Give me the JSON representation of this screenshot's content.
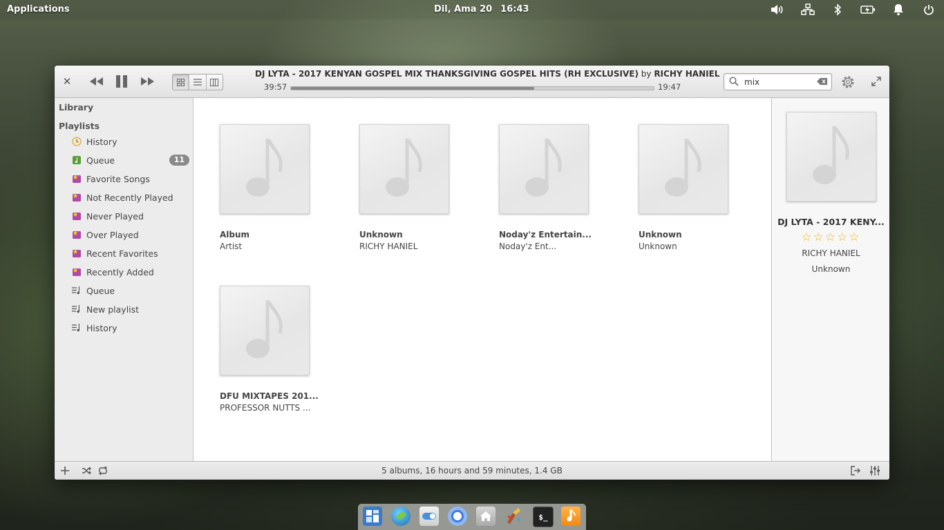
{
  "panel": {
    "applications_label": "Applications",
    "date": "Dil, Ama 20",
    "time": "16:43"
  },
  "player": {
    "track_title": "DJ LYTA  - 2017 KENYAN GOSPEL MIX  THANKSGIVING GOSPEL HITS (RH EXCLUSIVE)",
    "by_word": "by",
    "track_artist": "RICHY HANIEL",
    "elapsed": "39:57",
    "remaining": "19:47",
    "progress_fraction": 0.67
  },
  "search": {
    "value": "mix"
  },
  "sidebar": {
    "library_label": "Library",
    "playlists_label": "Playlists",
    "items": [
      {
        "label": "History",
        "icon": "history-icon"
      },
      {
        "label": "Queue",
        "icon": "queue-icon",
        "badge": "11"
      },
      {
        "label": "Favorite Songs",
        "icon": "smart-playlist-icon"
      },
      {
        "label": "Not Recently Played",
        "icon": "smart-playlist-icon"
      },
      {
        "label": "Never Played",
        "icon": "smart-playlist-icon"
      },
      {
        "label": "Over Played",
        "icon": "smart-playlist-icon"
      },
      {
        "label": "Recent Favorites",
        "icon": "smart-playlist-icon"
      },
      {
        "label": "Recently Added",
        "icon": "smart-playlist-icon"
      },
      {
        "label": "Queue",
        "icon": "playlist-icon"
      },
      {
        "label": "New playlist",
        "icon": "playlist-icon"
      },
      {
        "label": "History",
        "icon": "playlist-icon"
      }
    ]
  },
  "albums": [
    {
      "title": "Album",
      "artist": "Artist"
    },
    {
      "title": "Unknown",
      "artist": "RICHY HANIEL"
    },
    {
      "title": "Noday'z  Entertain...",
      "artist": "Noday'z  Ent..."
    },
    {
      "title": "Unknown",
      "artist": "Unknown"
    },
    {
      "title": "DFU MIXTAPES 201...",
      "artist": "PROFESSOR NUTTS ..."
    }
  ],
  "info_pane": {
    "title": "DJ LYTA  - 2017 KENY...",
    "stars": "☆☆☆☆☆",
    "artist": "RICHY HANIEL",
    "album": "Unknown"
  },
  "status_bar": {
    "text": "5 albums, 16 hours and 59 minutes, 1.4 GB"
  },
  "colors": {
    "star": "#f0b400",
    "badge": "#8a8a8a",
    "accent_orange": "#f59a1f"
  },
  "dock": [
    "multitasking-view-icon",
    "web-browser-icon",
    "settings-icon",
    "chromium-icon",
    "files-icon",
    "paint-icon",
    "terminal-icon",
    "music-icon"
  ]
}
